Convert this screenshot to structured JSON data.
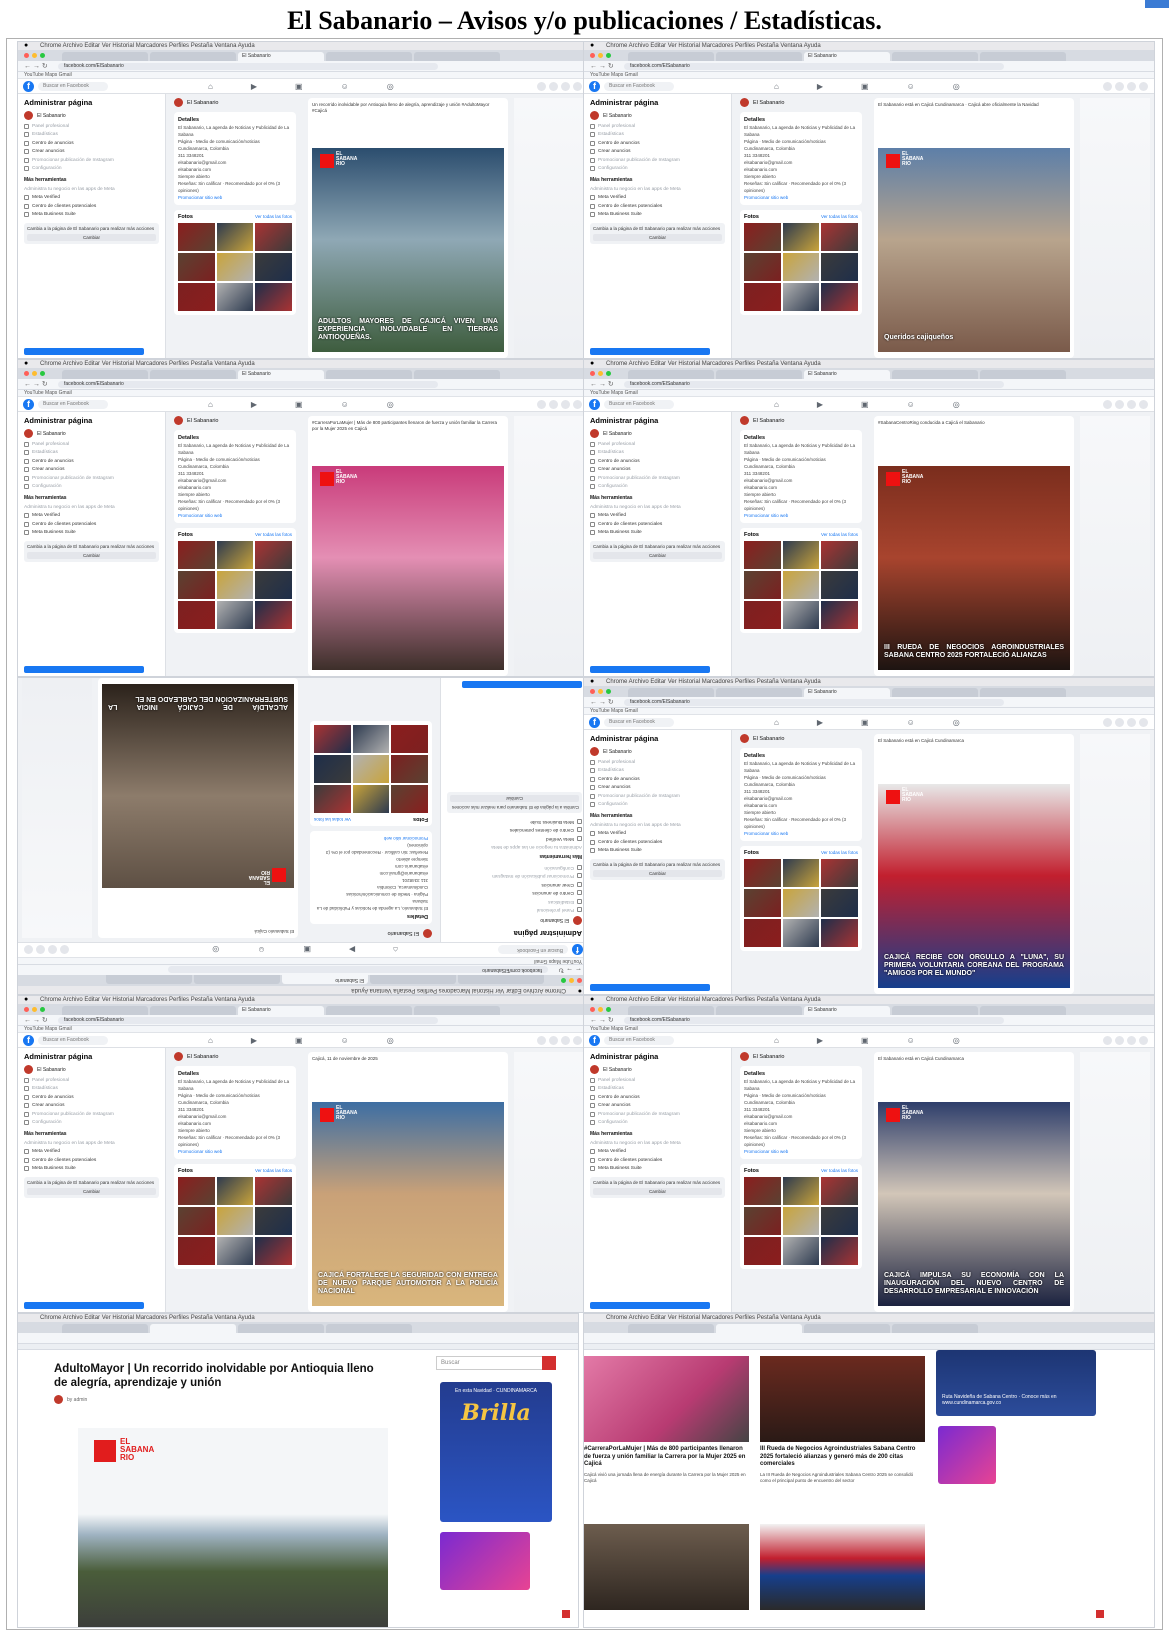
{
  "document": {
    "title": "El Sabanario – Avisos y/o publicaciones / Estadísticas."
  },
  "browser": {
    "menu": "Chrome  Archivo  Editar  Ver  Historial  Marcadores  Perfiles  Pestaña  Ventana  Ayuda",
    "url_facebook": "facebook.com/ElSabanario",
    "bookmarks": "YouTube  Maps  Gmail"
  },
  "facebook": {
    "search_placeholder": "Buscar en Facebook",
    "admin_title": "Administrar página",
    "page_name": "El Sabanario",
    "menu": [
      {
        "label": "Panel profesional",
        "muted": true
      },
      {
        "label": "Estadísticas",
        "muted": true
      },
      {
        "label": "Centro de anuncios",
        "muted": false
      },
      {
        "label": "Crear anuncios",
        "muted": false
      },
      {
        "label": "Promocionar publicación de Instagram",
        "muted": true
      },
      {
        "label": "Configuración",
        "muted": true
      }
    ],
    "more_tools": "Más herramientas",
    "more_tools_sub": "Administra tu negocio en las apps de Meta",
    "tools": [
      "Meta Verified",
      "Centro de clientes potenciales",
      "Meta Business Suite"
    ],
    "promo": "Cambia a la página de El Sabanario para realizar más acciones",
    "switch_button": "Cambiar",
    "details_title": "Detalles",
    "details_desc": "El Sabanario, La agenda de Noticias y Publicidad de La Sabana",
    "details_lines": [
      "Página · Medio de comunicación/noticias",
      "Cundinamarca, Colombia",
      "311 3348201",
      "elsabanario@gmail.com",
      "elsabanario.com",
      "Siempre abierto",
      "Reseñas: Sin calificar · Recomendado por el 0% (3 opiniones)"
    ],
    "promote_website": "Promocionar sitio web",
    "photos_title": "Fotos",
    "photos_link": "Ver todas las fotos"
  },
  "posts": [
    {
      "id": "p1",
      "caption": "ADULTOS MAYORES DE CAJICÁ VIVEN UNA EXPERIENCIA INOLVIDABLE EN TIERRAS ANTIOQUEÑAS.",
      "text": "Un recorrido inolvidable por Antioquia lleno de alegría, aprendizaje y unión #AdultoMayor #Cajicá"
    },
    {
      "id": "p2",
      "caption": "Queridos cajiqueños",
      "text": "El Sabanario está en Cajicá Cundinamarca · Cajicá abre oficialmente la Navidad"
    },
    {
      "id": "p3",
      "caption": "",
      "text": "#CarreraPorLaMujer | Más de 800 participantes llenaron de fuerza y unión familiar la Carrera por la Mujer 2025 en Cajicá"
    },
    {
      "id": "p4",
      "caption": "III RUEDA DE NEGOCIOS AGROINDUSTRIALES SABANA CENTRO 2025 FORTALECIÓ ALIANZAS",
      "text": "#SabanaCentroRing conducida a Cajicá el Sabanario"
    },
    {
      "id": "p5",
      "caption": "ALCALDÍA DE CAJICÁ INICIA LA SUBTERRANIZACIÓN DEL CABLEADO EN EL",
      "text": "El Sabanario Cajicá"
    },
    {
      "id": "p6",
      "caption": "CAJICÁ RECIBE CON ORGULLO A \"LUNA\", SU PRIMERA VOLUNTARIA COREANA DEL PROGRAMA \"AMIGOS POR EL MUNDO\"",
      "text": "El Sabanario está en Cajicá Cundinamarca"
    },
    {
      "id": "p7",
      "caption": "CAJICÁ FORTALECE LA SEGURIDAD CON ENTREGA DE NUEVO PARQUE AUTOMOTOR A LA POLICÍA NACIONAL",
      "text": "Cajicá, 11 de noviembre de 2025"
    },
    {
      "id": "p8",
      "caption": "CAJICÁ IMPULSA SU ECONOMÍA CON LA INAUGURACIÓN DEL NUEVO CENTRO DE DESARROLLO EMPRESARIAL E INNOVACIÓN",
      "text": "El Sabanario está en Cajicá Cundinamarca"
    }
  ],
  "brand_logo": [
    "EL",
    "SABANA",
    "RIO"
  ],
  "web": {
    "article_title": "AdultoMayor | Un recorrido inolvidable por Antioquia lleno de alegría, aprendizaje y unión",
    "byline": "by admin",
    "search_placeholder": "Buscar",
    "ad_title": "Brilla",
    "ad_sub": "En esta Navidad · CUNDINAMARCA",
    "card1_title": "#CarreraPorLaMujer | Más de 800 participantes llenaron de fuerza y unión familiar la Carrera por la Mujer 2025 en Cajicá",
    "card1_desc": "Cajicá vivió una jornada llena de energía durante la Carrera por la Mujer 2025 en Cajicá",
    "card2_title": "III Rueda de Negocios Agroindustriales Sabana Centro 2025 fortaleció alianzas y generó más de 200 citas comerciales",
    "card2_desc": "La III Rueda de Negocios Agroindustriales Sabana Centro 2025 se consolidó como el principal punto de encuentro del sector",
    "route_banner": "Ruta Navideña de Sabana Centro · Conoce más en www.cundinamarca.gov.co"
  },
  "colors": {
    "facebook_blue": "#1877f2",
    "brand_red": "#e11d1d",
    "background": "#f0f2f5"
  }
}
